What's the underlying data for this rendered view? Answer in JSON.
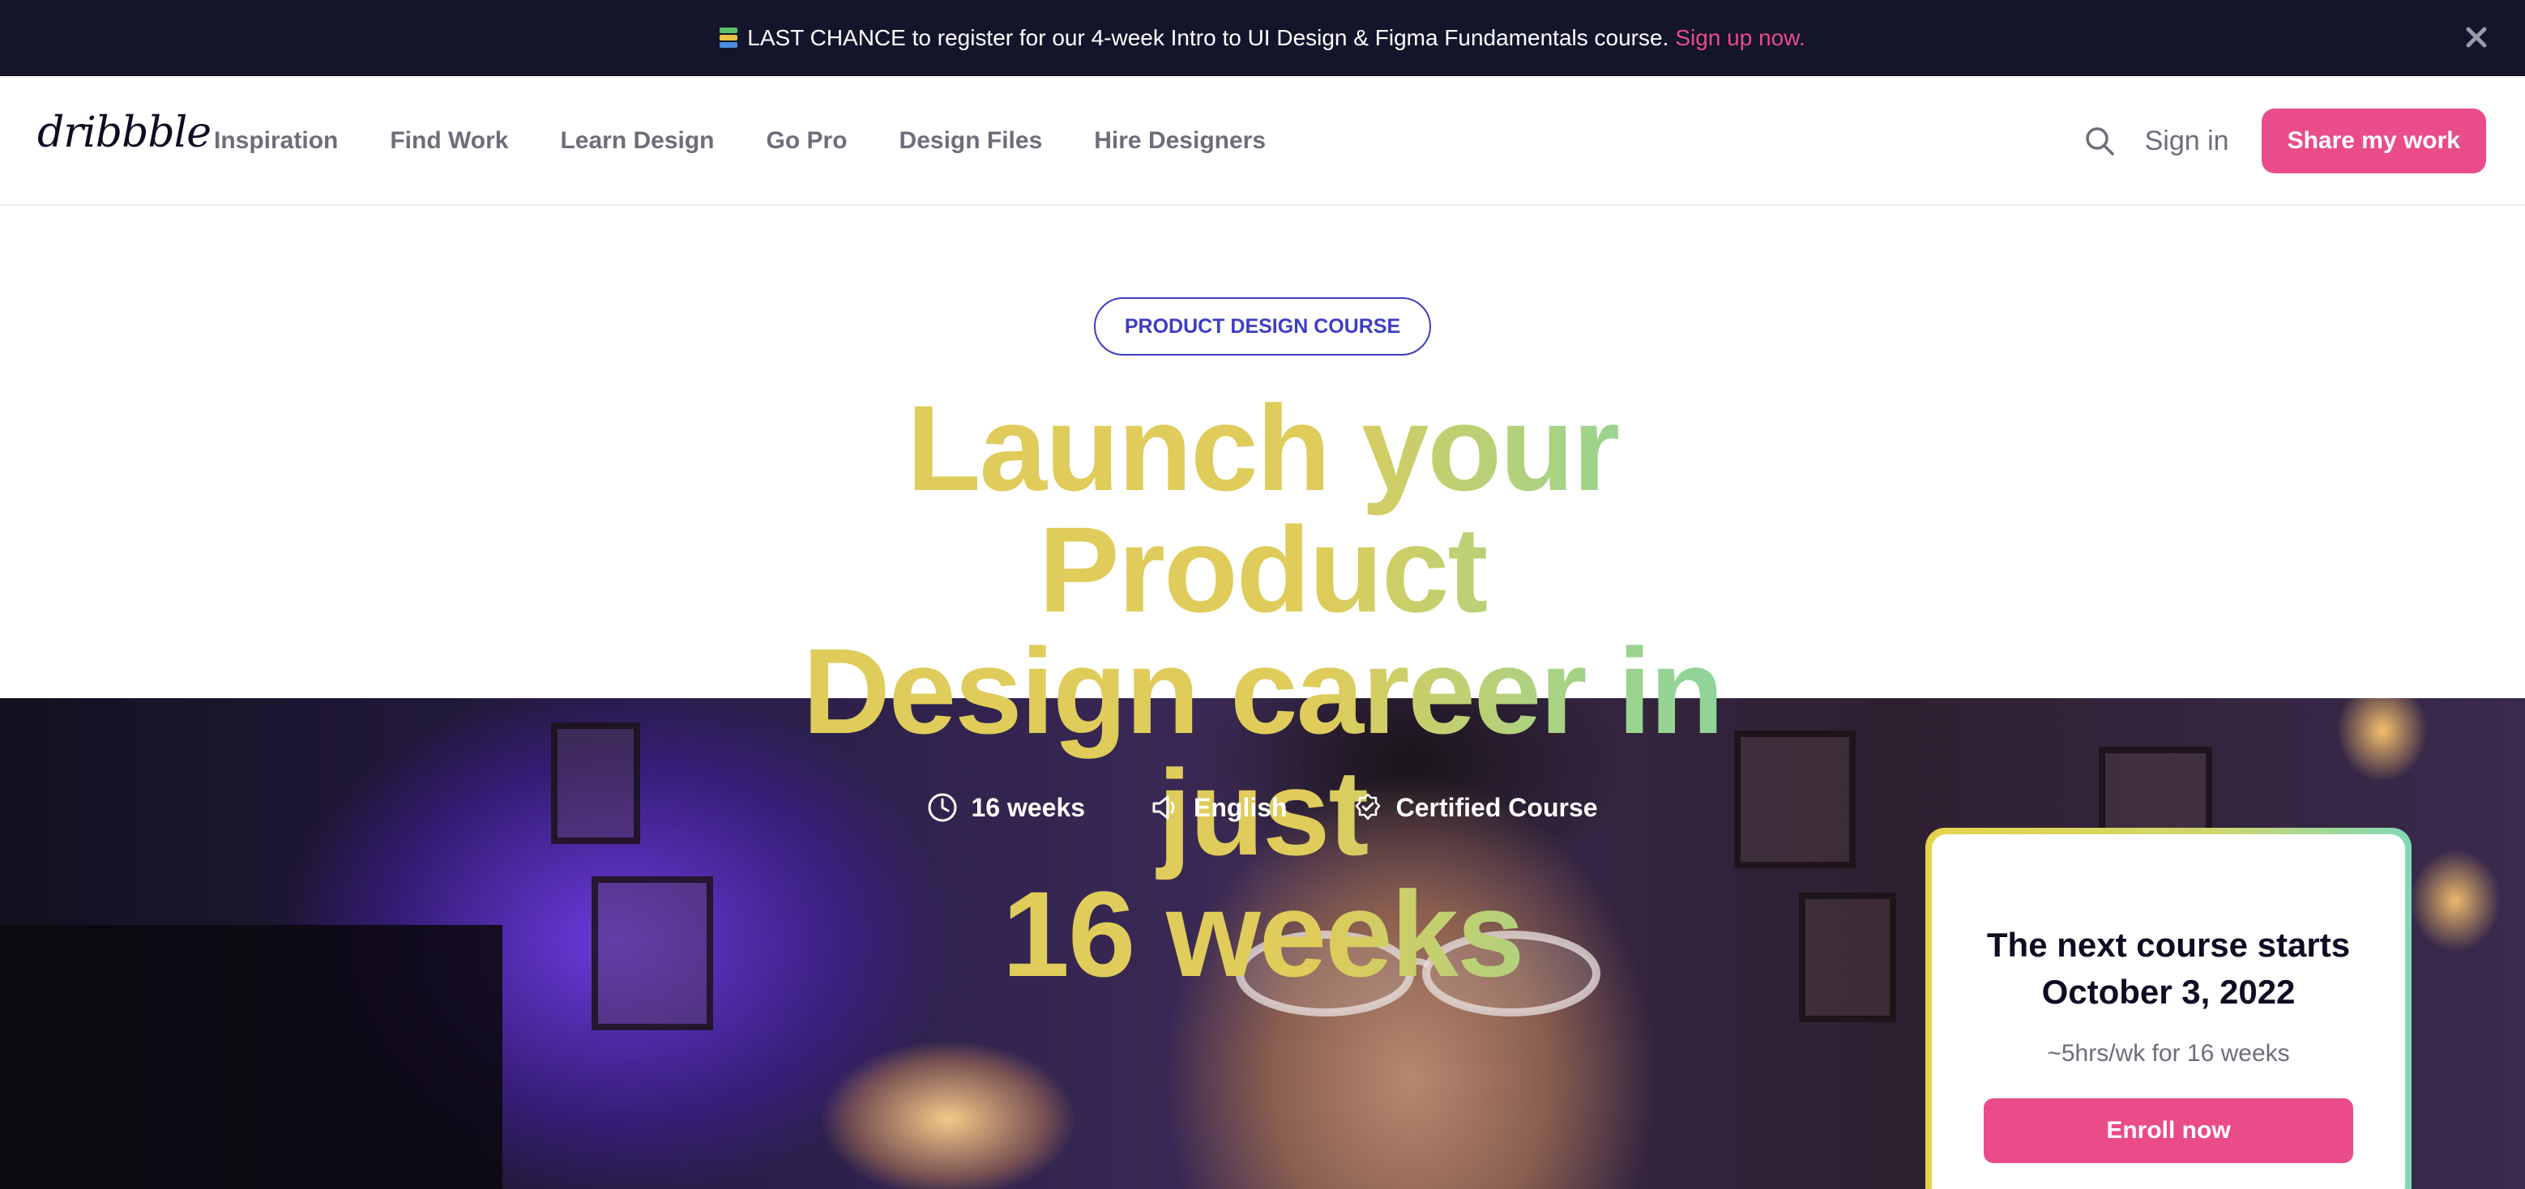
{
  "announcement": {
    "text": "LAST CHANCE to register for our 4-week Intro to UI Design & Figma Fundamentals course.",
    "link": "Sign up now.",
    "icon": "books-icon",
    "close_icon": "close-icon"
  },
  "nav": {
    "logo": "dribbble",
    "links": [
      "Inspiration",
      "Find Work",
      "Learn Design",
      "Go Pro",
      "Design Files",
      "Hire Designers"
    ],
    "search_icon": "search-icon",
    "sign_in": "Sign in",
    "share_button": "Share my work"
  },
  "hero": {
    "badge": "PRODUCT DESIGN COURSE",
    "headline_lines": [
      "Launch your Product",
      "Design career in just",
      "16 weeks"
    ],
    "meta": [
      {
        "icon": "clock-icon",
        "label": "16 weeks"
      },
      {
        "icon": "speaker-icon",
        "label": "English"
      },
      {
        "icon": "certified-badge-icon",
        "label": "Certified Course"
      }
    ]
  },
  "card": {
    "title_line1": "The next course starts",
    "title_line2": "October 3, 2022",
    "subtitle": "~5hrs/wk for 16 weeks",
    "cta": "Enroll now"
  },
  "colors": {
    "brand_pink": "#ea4c89",
    "announcement_bg": "#14142b",
    "badge_blue": "#3d3dc4",
    "headline_yellow": "#dfcc5a",
    "headline_green": "#7fd6a6"
  }
}
